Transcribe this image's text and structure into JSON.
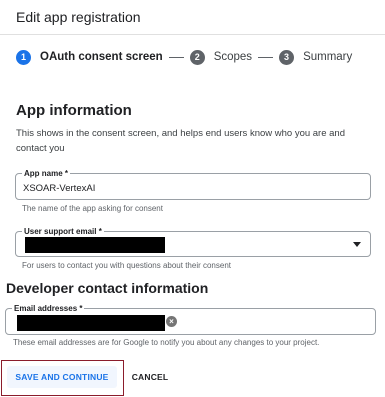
{
  "header": {
    "title": "Edit app registration"
  },
  "stepper": {
    "steps": [
      {
        "number": "1",
        "label": "OAuth consent screen",
        "active": true
      },
      {
        "number": "2",
        "label": "Scopes",
        "active": false
      },
      {
        "number": "3",
        "label": "Summary",
        "active": false
      }
    ]
  },
  "app_information": {
    "heading": "App information",
    "description": "This shows in the consent screen, and helps end users know who you are and contact you"
  },
  "fields": {
    "app_name": {
      "label": "App name *",
      "value": "XSOAR-VertexAI",
      "helper": "The name of the app asking for consent"
    },
    "user_support_email": {
      "label": "User support email *",
      "helper": "For users to contact you with questions about their consent"
    },
    "email_addresses": {
      "label": "Email addresses *",
      "helper": "These email addresses are for Google to notify you about any changes to your project."
    }
  },
  "developer_contact": {
    "heading": "Developer contact information"
  },
  "actions": {
    "save_label": "SAVE AND CONTINUE",
    "cancel_label": "CANCEL"
  },
  "colors": {
    "accent": "#1a73e8",
    "highlight_frame": "#8b1c2b",
    "redaction": "#000000"
  },
  "icons": {
    "dropdown": "chevron-down-icon",
    "clear": "clear-chip-icon"
  }
}
